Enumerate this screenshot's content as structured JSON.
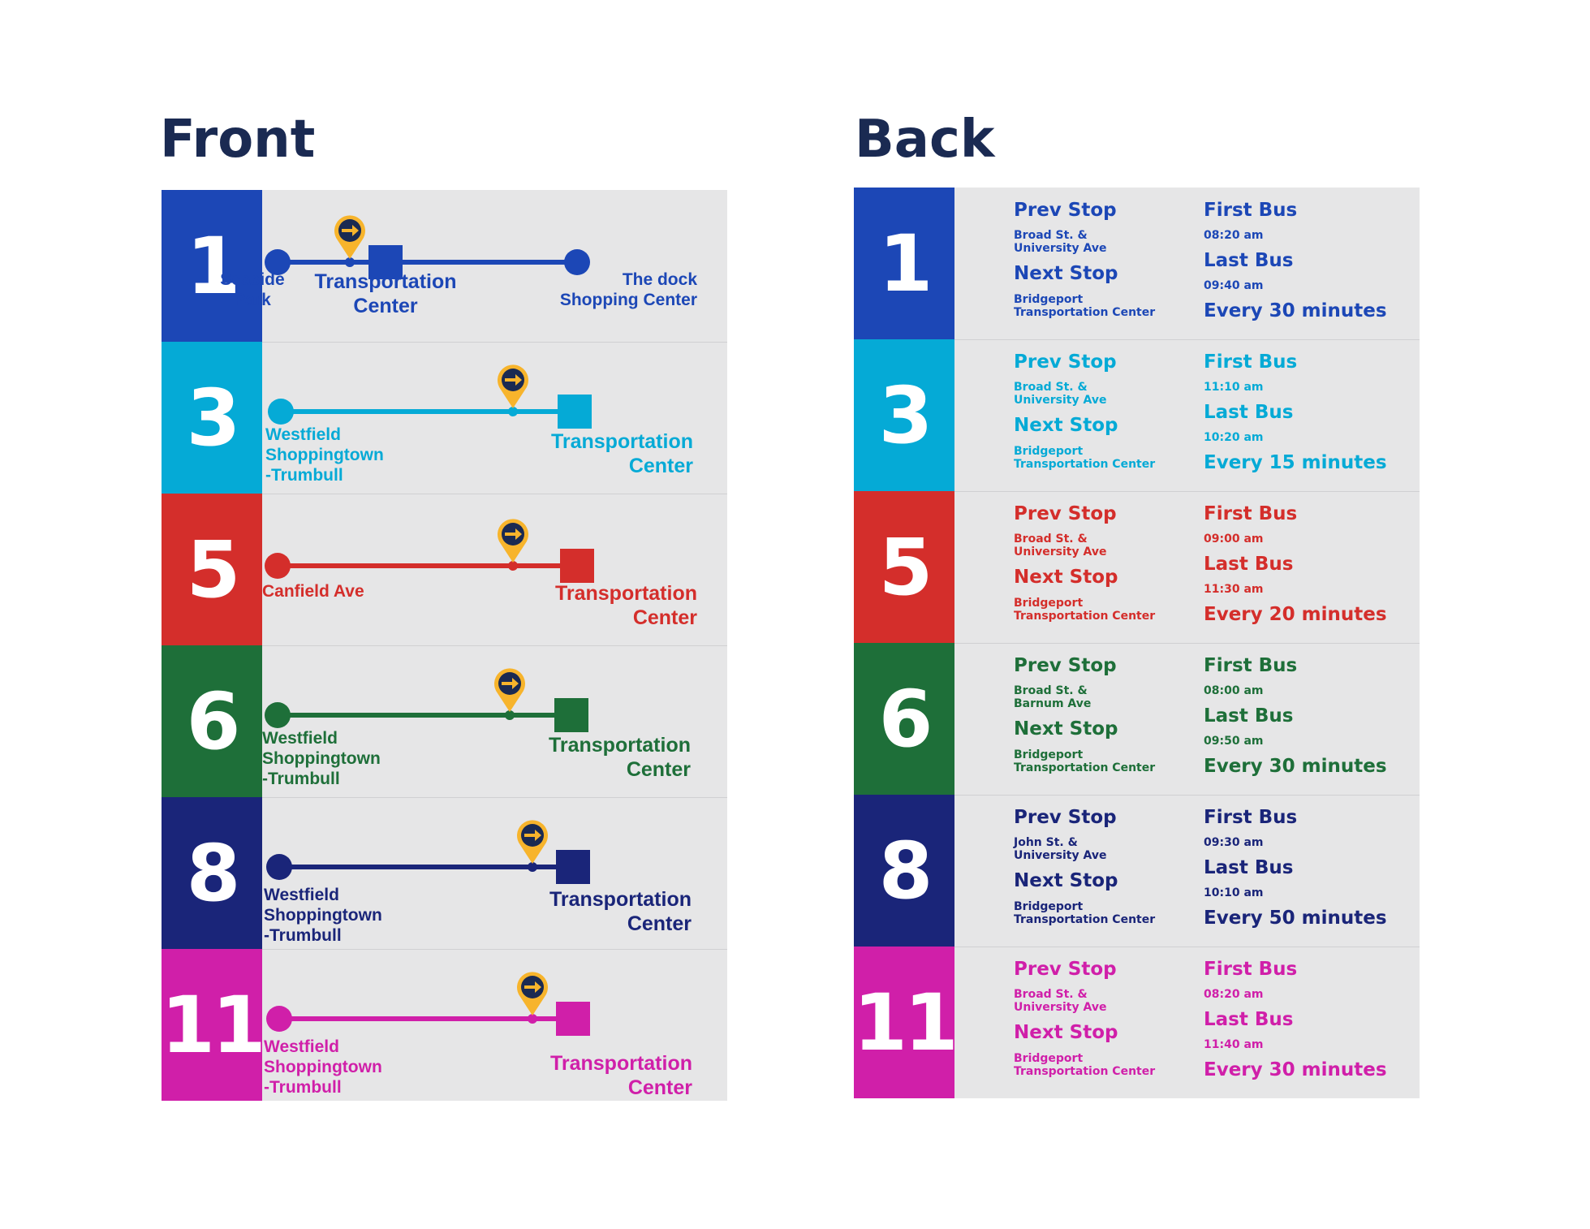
{
  "front": {
    "title": "Front",
    "routes": [
      {
        "number": "1",
        "color": "#1c47b6",
        "start_label": "Seaside\nPark",
        "middle_label": "Transportation\nCenter",
        "end_label": "The dock\nShopping Center"
      },
      {
        "number": "3",
        "color": "#05aad6",
        "start_label": "Westfield\nShoppingtown\n-Trumbull",
        "end_label": "Transportation\nCenter"
      },
      {
        "number": "5",
        "color": "#d42e2b",
        "start_label": "Canfield Ave",
        "end_label": "Transportation\nCenter"
      },
      {
        "number": "6",
        "color": "#1e6f39",
        "start_label": "Westfield\nShoppingtown\n-Trumbull",
        "end_label": "Transportation\nCenter"
      },
      {
        "number": "8",
        "color": "#1a2579",
        "start_label": "Westfield\nShoppingtown\n-Trumbull",
        "end_label": "Transportation\nCenter"
      },
      {
        "number": "11",
        "color": "#d01fa9",
        "start_label": "Westfield\nShoppingtown\n-Trumbull",
        "end_label": "Transportation\nCenter"
      }
    ]
  },
  "back": {
    "title": "Back",
    "prev_heading": "Prev Stop",
    "next_heading": "Next Stop",
    "first_heading": "First Bus",
    "last_heading": "Last Bus",
    "routes": [
      {
        "number": "1",
        "color": "#1c47b6",
        "prev_stop": "Broad St. &\nUniversity Ave",
        "next_stop": "Bridgeport\nTransportation Center",
        "first_bus": "08:20 am",
        "last_bus": "09:40 am",
        "frequency": "Every 30 minutes"
      },
      {
        "number": "3",
        "color": "#05aad6",
        "prev_stop": "Broad St. &\nUniversity Ave",
        "next_stop": "Bridgeport\nTransportation Center",
        "first_bus": "11:10 am",
        "last_bus": "10:20 am",
        "frequency": "Every 15 minutes"
      },
      {
        "number": "5",
        "color": "#d42e2b",
        "prev_stop": "Broad St. &\nUniversity Ave",
        "next_stop": "Bridgeport\nTransportation Center",
        "first_bus": "09:00 am",
        "last_bus": "11:30 am",
        "frequency": "Every 20 minutes"
      },
      {
        "number": "6",
        "color": "#1e6f39",
        "prev_stop": "Broad St. &\nBarnum Ave",
        "next_stop": "Bridgeport\nTransportation Center",
        "first_bus": "08:00 am",
        "last_bus": "09:50 am",
        "frequency": "Every 30 minutes"
      },
      {
        "number": "8",
        "color": "#1a2579",
        "prev_stop": "John St. &\nUniversity Ave",
        "next_stop": "Bridgeport\nTransportation Center",
        "first_bus": "09:30 am",
        "last_bus": "10:10 am",
        "frequency": "Every 50 minutes"
      },
      {
        "number": "11",
        "color": "#d01fa9",
        "prev_stop": "Broad St. &\nUniversity Ave",
        "next_stop": "Bridgeport\nTransportation Center",
        "first_bus": "08:20 am",
        "last_bus": "11:40 am",
        "frequency": "Every 30 minutes"
      }
    ]
  },
  "icons": {
    "pin": "location-pin-arrow-icon",
    "pin_color": "#f7b42c",
    "pin_inner": "#1a2a52"
  }
}
